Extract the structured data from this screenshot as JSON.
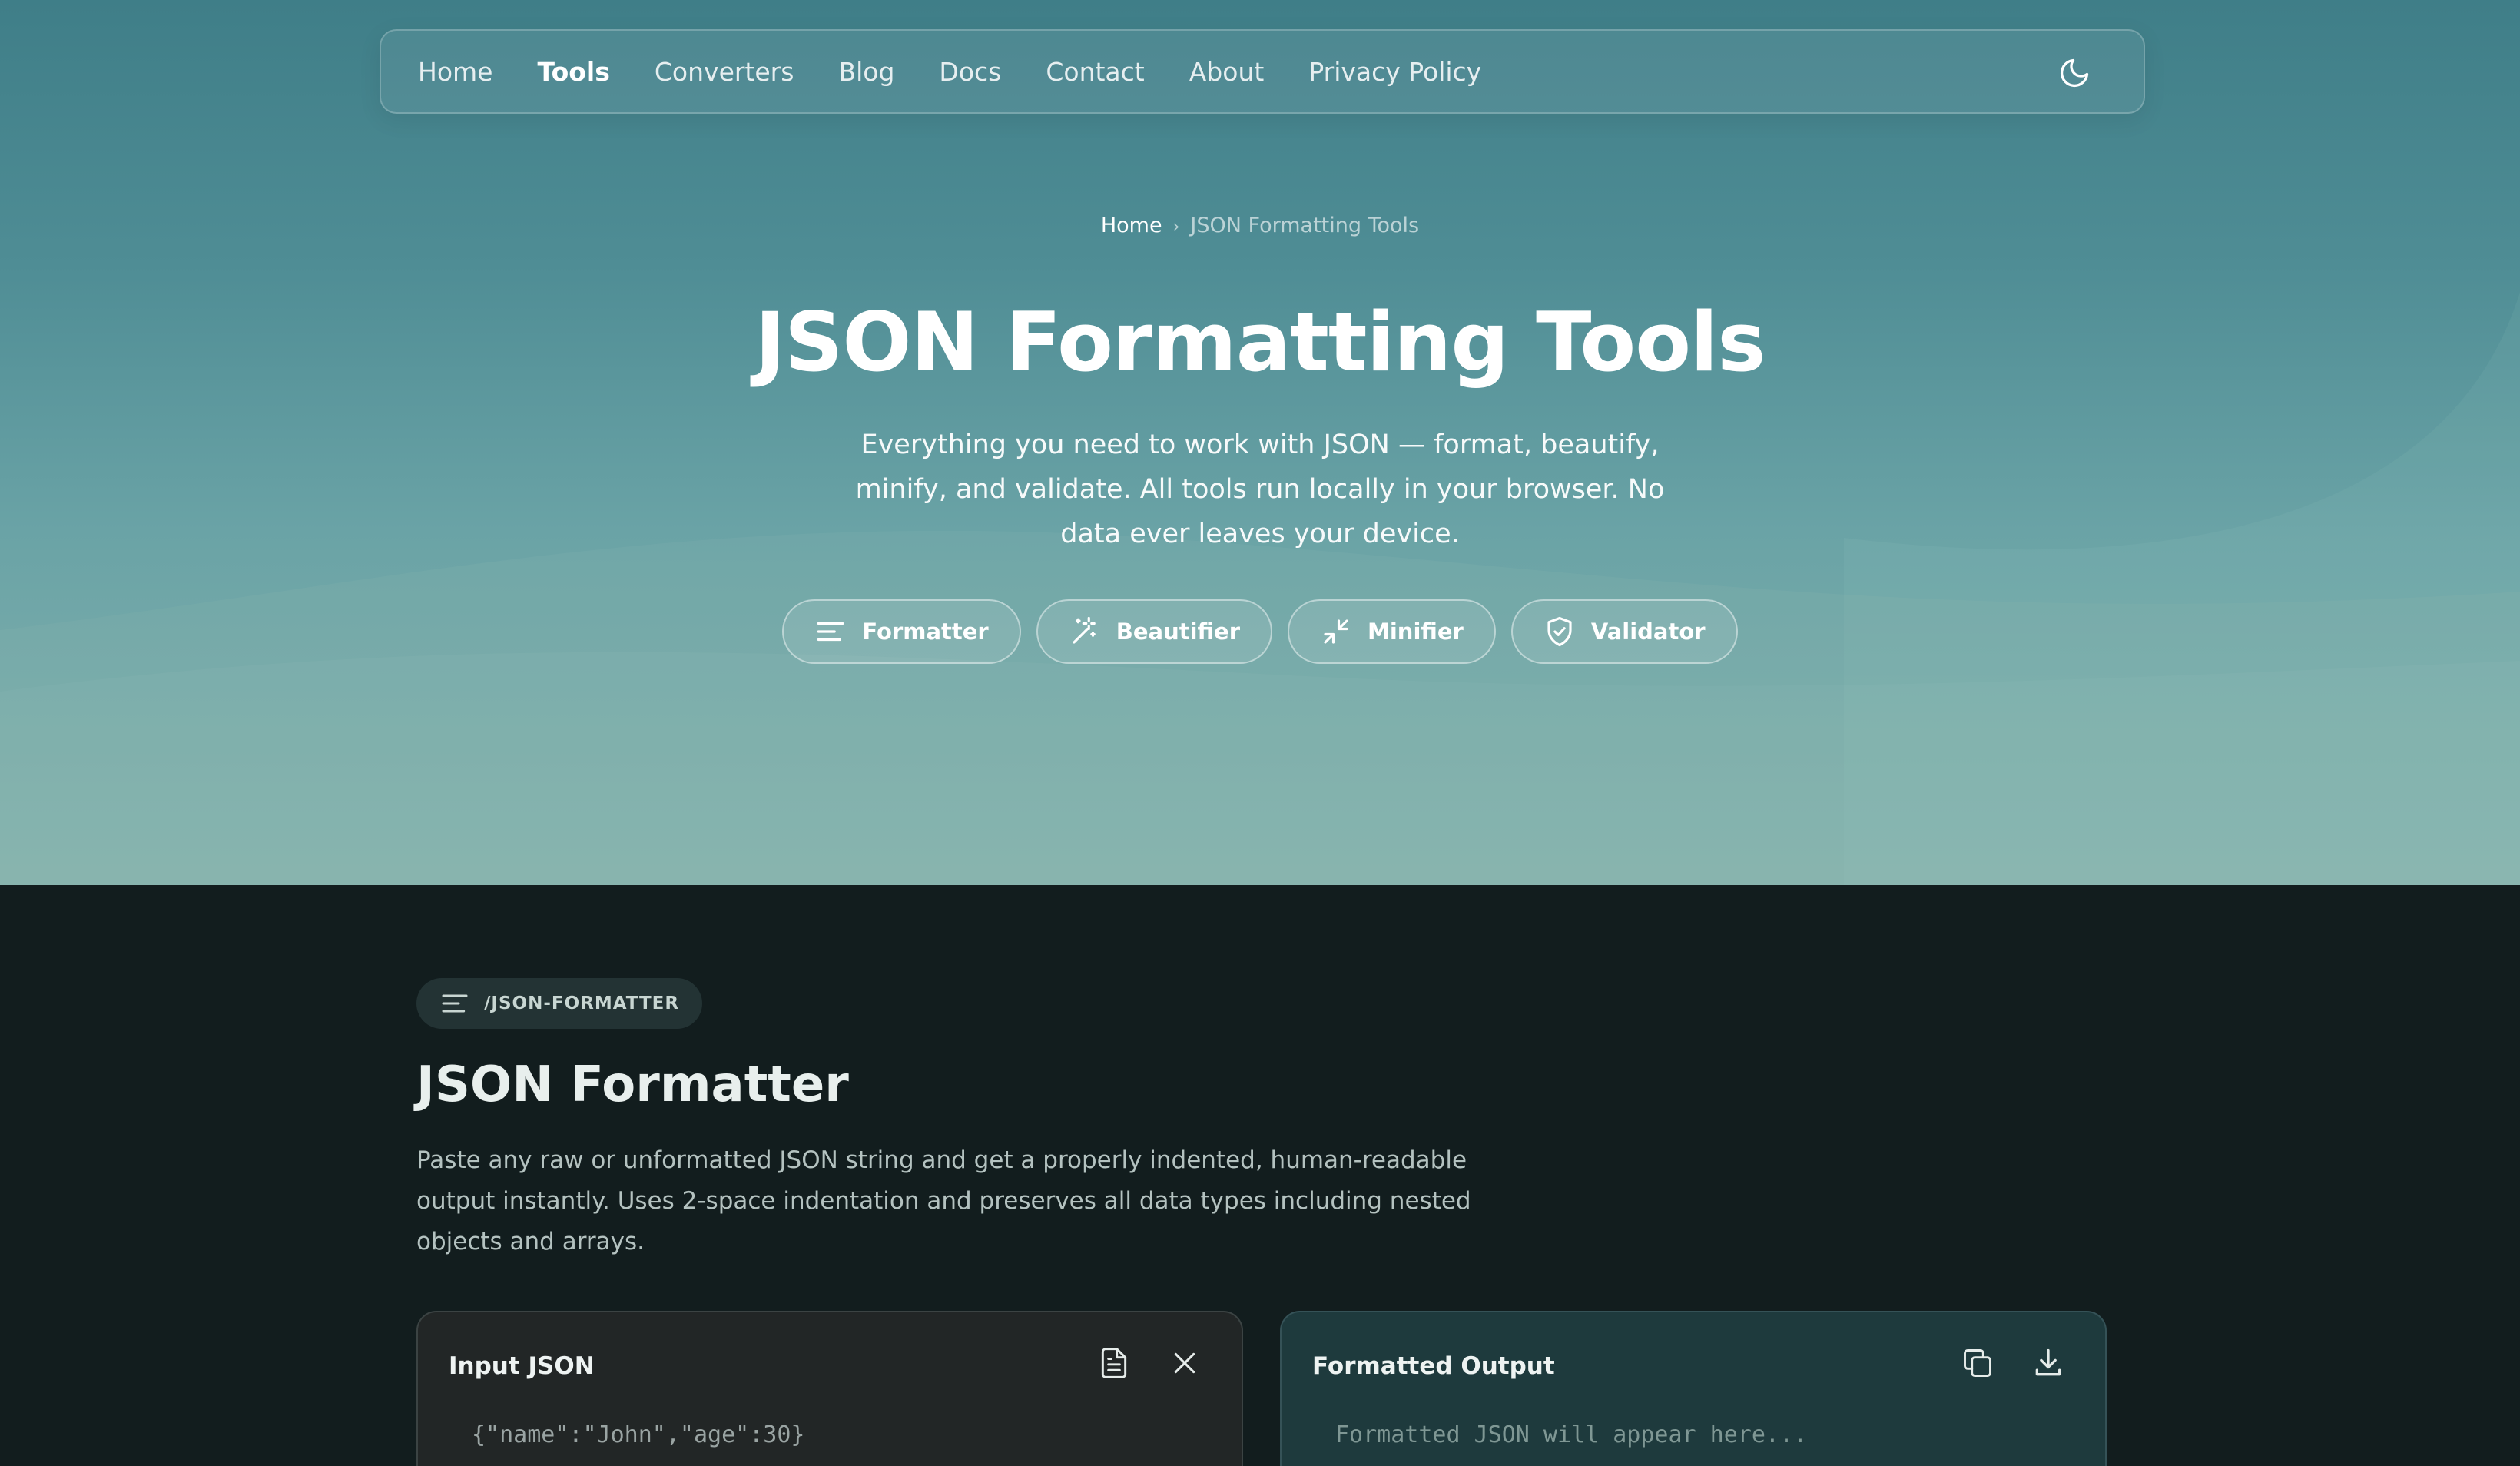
{
  "nav": {
    "items": [
      {
        "label": "Home",
        "active": false
      },
      {
        "label": "Tools",
        "active": true
      },
      {
        "label": "Converters",
        "active": false
      },
      {
        "label": "Blog",
        "active": false
      },
      {
        "label": "Docs",
        "active": false
      },
      {
        "label": "Contact",
        "active": false
      },
      {
        "label": "About",
        "active": false
      },
      {
        "label": "Privacy Policy",
        "active": false
      }
    ],
    "theme_icon": "moon-icon"
  },
  "breadcrumb": {
    "home": "Home",
    "separator": "›",
    "current": "JSON Formatting Tools"
  },
  "hero": {
    "title": "JSON Formatting Tools",
    "subtitle": "Everything you need to work with JSON — format, beautify, minify, and validate. All tools run locally in your browser. No data ever leaves your device.",
    "pills": [
      {
        "label": "Formatter",
        "icon": "align-left-icon"
      },
      {
        "label": "Beautifier",
        "icon": "magic-wand-icon"
      },
      {
        "label": "Minifier",
        "icon": "minimize-icon"
      },
      {
        "label": "Validator",
        "icon": "shield-check-icon"
      }
    ]
  },
  "section": {
    "tag": "/JSON-FORMATTER",
    "title": "JSON Formatter",
    "description": "Paste any raw or unformatted JSON string and get a properly indented, human-readable output instantly. Uses 2-space indentation and preserves all data types including nested objects and arrays."
  },
  "input_panel": {
    "title": "Input JSON",
    "placeholder": "{\"name\":\"John\",\"age\":30}",
    "icons": [
      "document-icon",
      "close-icon"
    ]
  },
  "output_panel": {
    "title": "Formatted Output",
    "placeholder": "Formatted JSON will appear here...",
    "icons": [
      "copy-icon",
      "download-icon"
    ]
  },
  "colors": {
    "hero_top": "#3f7e88",
    "hero_bottom": "#86b3ad",
    "page_bg": "#121d1e",
    "input_panel_bg": "#222626",
    "output_panel_bg": "#1e3a3d"
  }
}
